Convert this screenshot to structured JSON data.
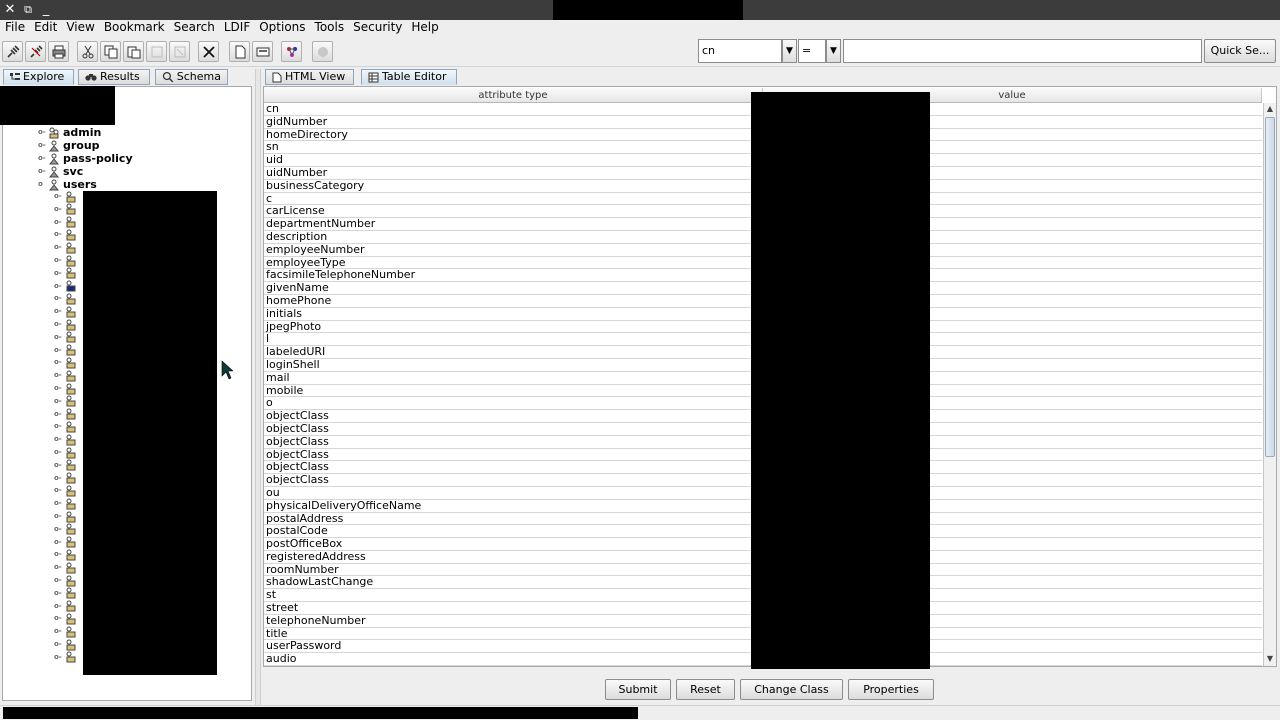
{
  "window": {
    "controls": [
      "✕",
      "⧉",
      "_"
    ]
  },
  "menubar": {
    "items": [
      "File",
      "Edit",
      "View",
      "Bookmark",
      "Search",
      "LDIF",
      "Options",
      "Tools",
      "Security",
      "Help"
    ]
  },
  "search": {
    "attribute": "cn",
    "operator": "=",
    "value": "",
    "quick_search_label": "Quick Se..."
  },
  "left_tabs": [
    {
      "label": "Explore",
      "icon": "tree-icon",
      "active": true
    },
    {
      "label": "Results",
      "icon": "binoculars-icon",
      "active": false
    },
    {
      "label": "Schema",
      "icon": "magnifier-icon",
      "active": false
    }
  ],
  "tree": {
    "nodes": [
      {
        "label": "admin",
        "expanded": false
      },
      {
        "label": "group",
        "expanded": false
      },
      {
        "label": "pass-policy",
        "expanded": false
      },
      {
        "label": "svc",
        "expanded": false
      },
      {
        "label": "users",
        "expanded": true
      }
    ],
    "child_count": 37
  },
  "right_tabs": [
    {
      "label": "HTML View",
      "icon": "document-icon",
      "active": false
    },
    {
      "label": "Table Editor",
      "icon": "table-icon",
      "active": true
    }
  ],
  "table": {
    "columns": [
      "attribute type",
      "value"
    ],
    "rows": [
      "cn",
      "gidNumber",
      "homeDirectory",
      "sn",
      "uid",
      "uidNumber",
      "businessCategory",
      "c",
      "carLicense",
      "departmentNumber",
      "description",
      "employeeNumber",
      "employeeType",
      "facsimileTelephoneNumber",
      "givenName",
      "homePhone",
      "initials",
      "jpegPhoto",
      "l",
      "labeledURI",
      "loginShell",
      "mail",
      "mobile",
      "o",
      "objectClass",
      "objectClass",
      "objectClass",
      "objectClass",
      "objectClass",
      "objectClass",
      "ou",
      "physicalDeliveryOfficeName",
      "postalAddress",
      "postalCode",
      "postOfficeBox",
      "registeredAddress",
      "roomNumber",
      "shadowLastChange",
      "st",
      "street",
      "telephoneNumber",
      "title",
      "userPassword",
      "audio"
    ]
  },
  "buttons": {
    "submit": "Submit",
    "reset": "Reset",
    "change_class": "Change Class",
    "properties": "Properties"
  },
  "colors": {
    "selection": "#1a2a7a",
    "tab_active": "#cfe0ef",
    "titlebar": "#3c3c3c"
  }
}
